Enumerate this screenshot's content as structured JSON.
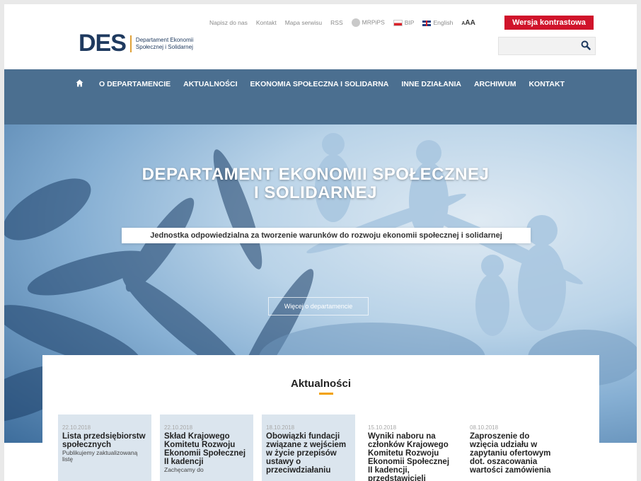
{
  "header": {
    "logo_mark": "DES",
    "logo_line1": "Departament Ekonomii",
    "logo_line2": "Społecznej i Solidarnej",
    "utility_links": [
      "Napisz do nas",
      "Kontakt",
      "Mapa serwisu",
      "RSS"
    ],
    "mrpips_label": "MRPiPS",
    "bip_label": "BIP",
    "english_label": "English",
    "font_size_label_small": "A",
    "font_size_label_large": "AA",
    "contrast_button": "Wersja kontrastowa",
    "search_placeholder": ""
  },
  "nav": {
    "items": [
      "O DEPARTAMENCIE",
      "AKTUALNOŚCI",
      "EKONOMIA SPOŁECZNA I SOLIDARNA",
      "INNE DZIAŁANIA",
      "ARCHIWUM",
      "KONTAKT"
    ]
  },
  "hero": {
    "title_line1": "DEPARTAMENT EKONOMII SPOŁECZNEJ",
    "title_line2": "I SOLIDARNEJ",
    "subtitle": "Jednostka odpowiedzialna za tworzenie warunków do rozwoju ekonomii społecznej i solidarnej",
    "button": "Więcej o departamencie"
  },
  "news": {
    "heading": "Aktualności",
    "cards": [
      {
        "date": "22.10.2018",
        "title": "Lista przedsiębiorstw społecznych",
        "desc": "Publikujemy zaktualizowaną listę"
      },
      {
        "date": "22.10.2018",
        "title": "Skład Krajowego Komitetu Rozwoju Ekonomii Społecznej II kadencji",
        "desc": "Zachęcamy do"
      },
      {
        "date": "18.10.2018",
        "title": "Obowiązki fundacji związane z wejściem w życie przepisów ustawy o przeciwdziałaniu",
        "desc": ""
      },
      {
        "date": "15.10.2018",
        "title": "Wyniki naboru na członków Krajowego Komitetu Rozwoju Ekonomii Społecznej II kadencji, przedstawicieli",
        "desc": ""
      },
      {
        "date": "08.10.2018",
        "title": "Zaproszenie do wzięcia udziału w zapytaniu ofertowym dot. oszacowania wartości zamówienia",
        "desc": ""
      }
    ]
  },
  "colors": {
    "nav_bg": "#4b6f90",
    "contrast_red": "#d0142b",
    "accent_orange": "#f2a100",
    "logo_navy": "#1f3a5f"
  }
}
